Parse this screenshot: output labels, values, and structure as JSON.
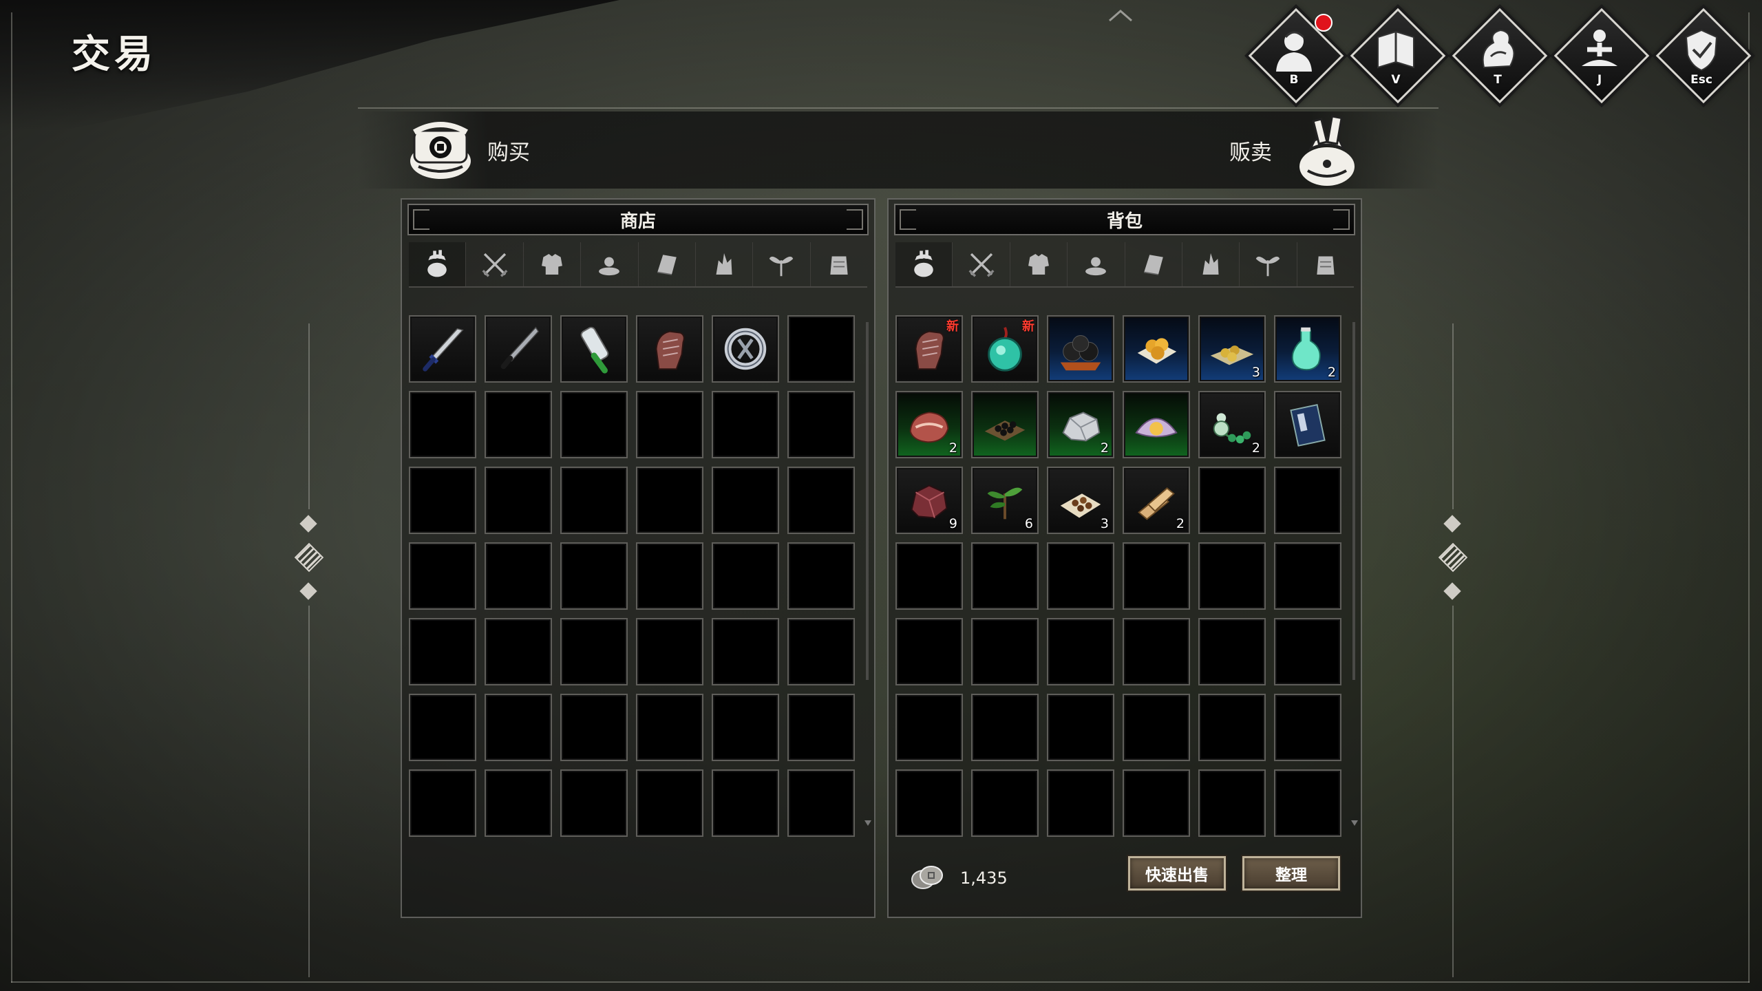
{
  "page": {
    "title": "交易"
  },
  "nav": [
    {
      "key": "B",
      "icon": "character-icon",
      "has_alert": true
    },
    {
      "key": "V",
      "icon": "book-icon",
      "has_alert": false
    },
    {
      "key": "T",
      "icon": "skills-icon",
      "has_alert": false
    },
    {
      "key": "J",
      "icon": "meditation-icon",
      "has_alert": false
    },
    {
      "key": "Esc",
      "icon": "system-icon",
      "has_alert": false
    }
  ],
  "trade": {
    "buy_label": "购买",
    "sell_label": "贩卖"
  },
  "shop": {
    "title": "商店",
    "tabs": [
      "all-tab",
      "weapon-tab",
      "armor-tab",
      "accessory-tab",
      "book-tab",
      "material-tab",
      "herb-tab",
      "misc-tab"
    ],
    "items": [
      {
        "icon": "sword-icon",
        "quality": "none"
      },
      {
        "icon": "dagger-icon",
        "quality": "none"
      },
      {
        "icon": "scroll-icon",
        "quality": "none"
      },
      {
        "icon": "gauntlet-icon",
        "quality": "none"
      },
      {
        "icon": "ring-icon",
        "quality": "none"
      }
    ],
    "rows": 7,
    "cols": 6
  },
  "bag": {
    "title": "背包",
    "tabs": [
      "all-tab",
      "weapon-tab",
      "armor-tab",
      "accessory-tab",
      "book-tab",
      "material-tab",
      "herb-tab",
      "misc-tab"
    ],
    "items": [
      {
        "icon": "gauntlet-icon",
        "quality": "none",
        "count": "",
        "new_label": "新"
      },
      {
        "icon": "jade-pendant-icon",
        "quality": "none",
        "count": "",
        "new_label": "新"
      },
      {
        "icon": "black-pearls-icon",
        "quality": "blue",
        "count": ""
      },
      {
        "icon": "gold-pills-icon",
        "quality": "blue",
        "count": ""
      },
      {
        "icon": "pill-tray-icon",
        "quality": "blue",
        "count": "3"
      },
      {
        "icon": "potion-icon",
        "quality": "blue",
        "count": "2"
      },
      {
        "icon": "meat-icon",
        "quality": "green",
        "count": "2"
      },
      {
        "icon": "beans-icon",
        "quality": "green",
        "count": ""
      },
      {
        "icon": "silver-ore-icon",
        "quality": "green",
        "count": "2"
      },
      {
        "icon": "clam-pearl-icon",
        "quality": "green",
        "count": ""
      },
      {
        "icon": "gourd-beads-icon",
        "quality": "none",
        "count": "2"
      },
      {
        "icon": "manual-icon",
        "quality": "none",
        "count": ""
      },
      {
        "icon": "red-ore-icon",
        "quality": "none",
        "count": "9"
      },
      {
        "icon": "herb-sprig-icon",
        "quality": "none",
        "count": "6"
      },
      {
        "icon": "seeds-icon",
        "quality": "none",
        "count": "3"
      },
      {
        "icon": "wood-icon",
        "quality": "none",
        "count": "2"
      }
    ],
    "rows": 7,
    "cols": 6,
    "money": "1,435",
    "quick_sell_label": "快速出售",
    "sort_label": "整理"
  },
  "colors": {
    "blue_quality": "#123d7a",
    "green_quality": "#11651f",
    "new_badge": "#ff3b2f",
    "alert": "#e0141c"
  }
}
